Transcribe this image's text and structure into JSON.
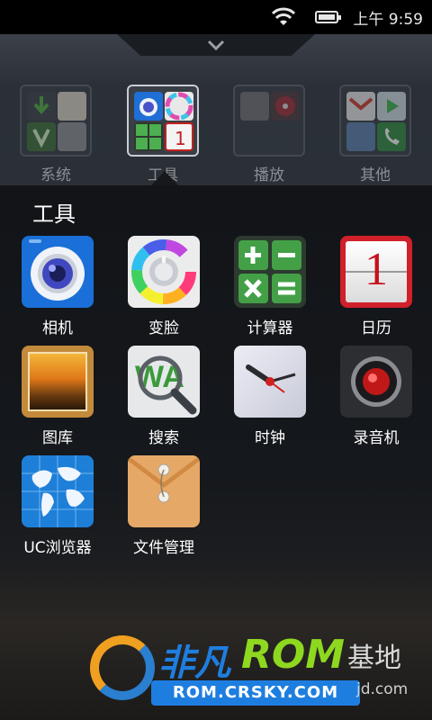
{
  "status_bar": {
    "time": "上午 9:59"
  },
  "folders": [
    {
      "label": "系统",
      "state": "inactive"
    },
    {
      "label": "工具",
      "state": "active"
    },
    {
      "label": "播放",
      "state": "inactive"
    },
    {
      "label": "其他",
      "state": "inactive"
    }
  ],
  "drawer": {
    "title": "工具",
    "apps": [
      {
        "label": "相机",
        "icon": "camera-icon"
      },
      {
        "label": "变脸",
        "icon": "color-wheel-icon"
      },
      {
        "label": "计算器",
        "icon": "calculator-icon"
      },
      {
        "label": "日历",
        "icon": "calendar-icon"
      },
      {
        "label": "图库",
        "icon": "gallery-icon"
      },
      {
        "label": "搜索",
        "icon": "search-magnifier-icon"
      },
      {
        "label": "时钟",
        "icon": "clock-icon"
      },
      {
        "label": "录音机",
        "icon": "recorder-icon"
      },
      {
        "label": "UC浏览器",
        "icon": "uc-browser-icon"
      },
      {
        "label": "文件管理",
        "icon": "file-manager-icon"
      }
    ],
    "calendar_day": "1",
    "search_icon_text": "WA"
  },
  "watermark": {
    "cn": "非凡",
    "rom": "ROM",
    "site": "ROM.CRSKY.COM",
    "jd": "基地",
    "url": "jd.com"
  },
  "colors": {
    "accent_blue": "#1e7ee0",
    "accent_green": "#8ed820"
  }
}
